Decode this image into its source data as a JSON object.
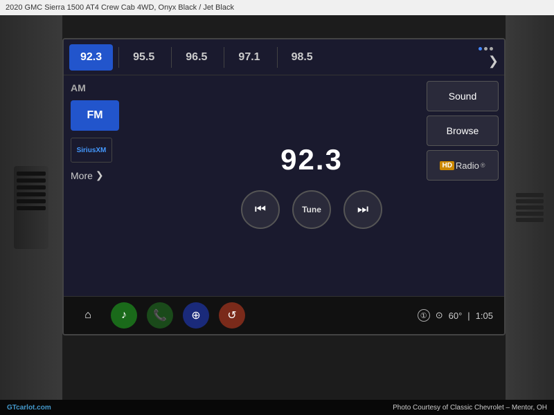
{
  "top_bar": {
    "title": "2020 GMC Sierra 1500 AT4 Crew Cab 4WD,",
    "color_trim": "Onyx Black / Jet Black"
  },
  "bottom_bar": {
    "left": "GTcarlot.com",
    "right": "Photo Courtesy of Classic Chevrolet – Mentor, OH"
  },
  "screen": {
    "presets": [
      {
        "label": "92.3",
        "active": true
      },
      {
        "label": "95.5",
        "active": false
      },
      {
        "label": "96.5",
        "active": false
      },
      {
        "label": "97.1",
        "active": false
      },
      {
        "label": "98.5",
        "active": false
      }
    ],
    "forward_icon": "❯",
    "band": {
      "am_label": "AM",
      "fm_label": "FM",
      "sirius_label": "SiriusXM",
      "more_label": "More",
      "more_chevron": "❯"
    },
    "frequency": "92.3",
    "controls": {
      "rewind_label": "⏮",
      "tune_label": "Tune",
      "forward_label": "⏭"
    },
    "right_panel": {
      "sound_label": "Sound",
      "browse_label": "Browse",
      "hd_label": "HD",
      "radio_label": "Radio"
    },
    "status_bar": {
      "home_icon": "⌂",
      "music_icon": "♪",
      "phone_icon": "📞",
      "nav_icon": "⊕",
      "settings_icon": "↺",
      "info_icon": "①",
      "location_icon": "⊙",
      "temperature": "60°",
      "time": "1:05"
    }
  },
  "colors": {
    "accent_blue": "#2255cc",
    "screen_bg": "#1a1a2e",
    "dark_bg": "#1c1c1c"
  }
}
